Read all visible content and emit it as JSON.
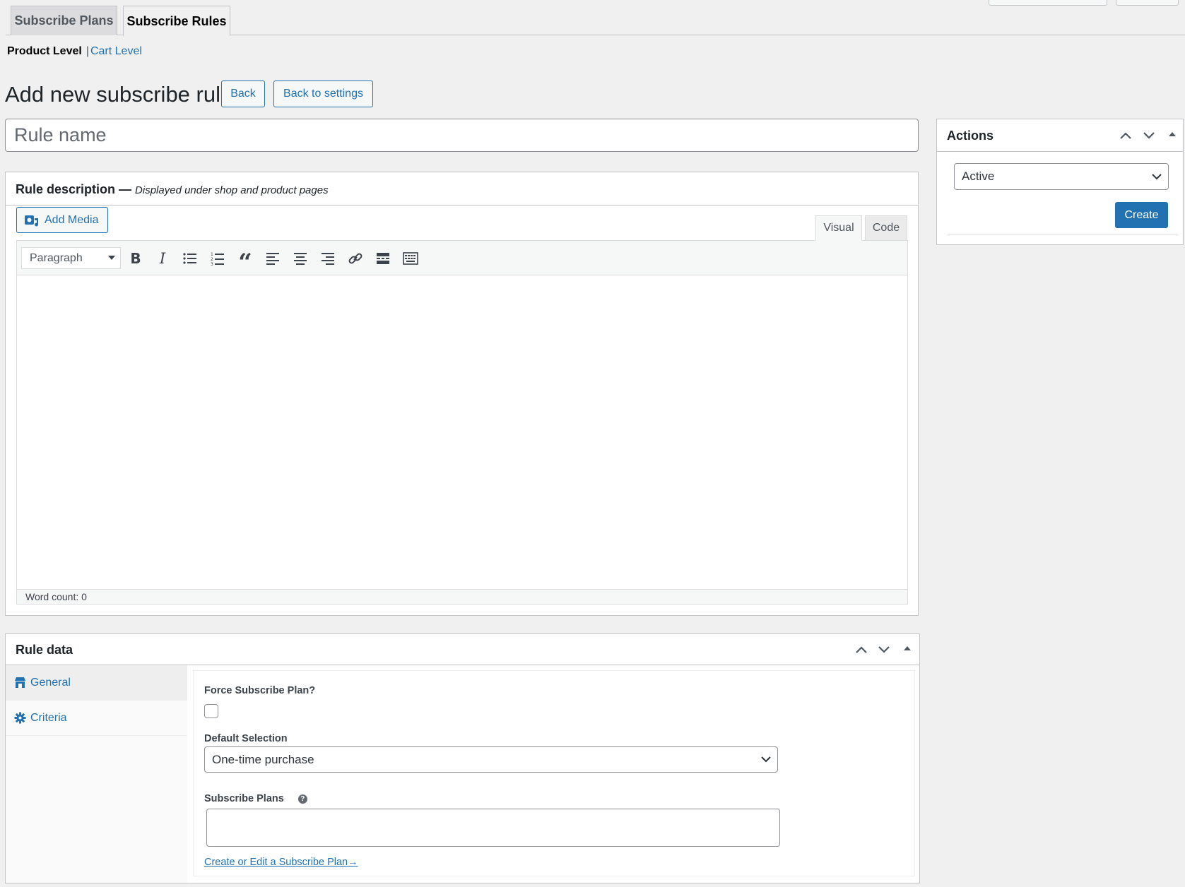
{
  "tabs": [
    {
      "label": "Subscribe Plans",
      "active": false
    },
    {
      "label": "Subscribe Rules",
      "active": true
    }
  ],
  "subsubsub": {
    "current": "Product Level",
    "separator": "|",
    "other": "Cart Level"
  },
  "header": {
    "title": "Add new subscribe rule",
    "back_label": "Back",
    "back_to_settings_label": "Back to settings"
  },
  "rule_name": {
    "placeholder": "Rule name",
    "value": ""
  },
  "description_box": {
    "title": "Rule description —",
    "subtitle": "Displayed under shop and product pages",
    "add_media_label": "Add Media",
    "editor_tabs": [
      "Visual",
      "Code"
    ],
    "format_select": "Paragraph",
    "word_count": "Word count: 0",
    "toolbar_icons": [
      "bold-icon",
      "italic-icon",
      "bullet-list-icon",
      "numbered-list-icon",
      "blockquote-icon",
      "align-left-icon",
      "align-center-icon",
      "align-right-icon",
      "link-icon",
      "read-more-icon",
      "toolbar-toggle-icon"
    ]
  },
  "actions_box": {
    "title": "Actions",
    "status_value": "Active",
    "create_label": "Create"
  },
  "rule_data": {
    "title": "Rule data",
    "side_tabs": [
      {
        "label": "General",
        "icon": "store-icon",
        "active": true
      },
      {
        "label": "Criteria",
        "icon": "gear-icon",
        "active": false
      }
    ],
    "force_label": "Force Subscribe Plan?",
    "force_checked": false,
    "default_selection_label": "Default Selection",
    "default_selection_value": "One-time purchase",
    "subscribe_plans_label": "Subscribe Plans",
    "create_edit_link": "Create or Edit a Subscribe Plan→"
  },
  "colors": {
    "accent": "#2271b1",
    "background": "#f0f0f1",
    "border": "#c3c4c7"
  }
}
